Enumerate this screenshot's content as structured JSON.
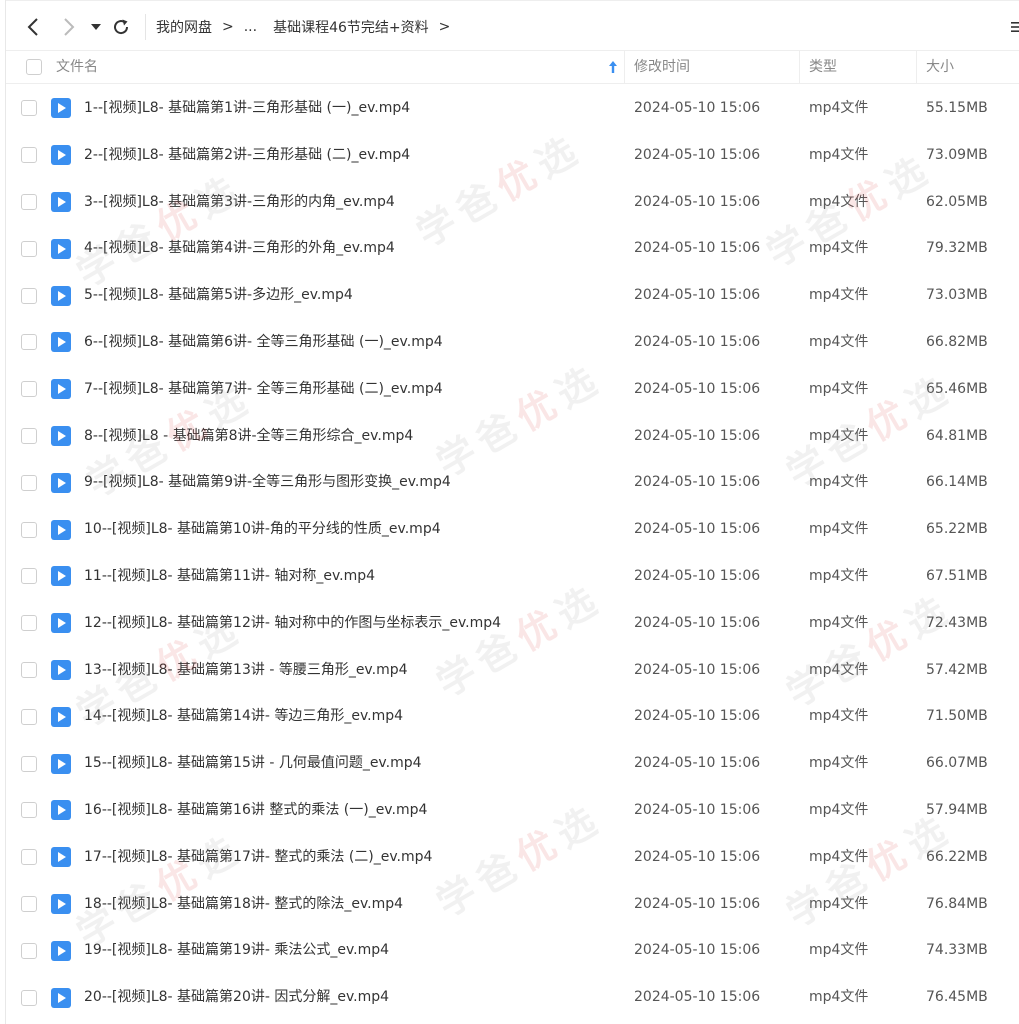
{
  "toolbar": {
    "back_icon": "chevron-left-icon",
    "forward_icon": "chevron-right-icon",
    "history_icon": "caret-down-icon",
    "refresh_icon": "refresh-icon",
    "breadcrumb": [
      "我的网盘",
      "...",
      "基础课程46节完结+资料"
    ],
    "menu_icon": "more-menu-icon"
  },
  "header": {
    "name": "文件名",
    "modified": "修改时间",
    "type": "类型",
    "size": "大小"
  },
  "files": [
    {
      "name": "1--[视频]L8- 基础篇第1讲-三角形基础 (一)_ev.mp4",
      "modified": "2024-05-10 15:06",
      "type": "mp4文件",
      "size": "55.15MB"
    },
    {
      "name": "2--[视频]L8- 基础篇第2讲-三角形基础 (二)_ev.mp4",
      "modified": "2024-05-10 15:06",
      "type": "mp4文件",
      "size": "73.09MB"
    },
    {
      "name": "3--[视频]L8- 基础篇第3讲-三角形的内角_ev.mp4",
      "modified": "2024-05-10 15:06",
      "type": "mp4文件",
      "size": "62.05MB"
    },
    {
      "name": "4--[视频]L8- 基础篇第4讲-三角形的外角_ev.mp4",
      "modified": "2024-05-10 15:06",
      "type": "mp4文件",
      "size": "79.32MB"
    },
    {
      "name": "5--[视频]L8- 基础篇第5讲-多边形_ev.mp4",
      "modified": "2024-05-10 15:06",
      "type": "mp4文件",
      "size": "73.03MB"
    },
    {
      "name": "6--[视频]L8- 基础篇第6讲- 全等三角形基础 (一)_ev.mp4",
      "modified": "2024-05-10 15:06",
      "type": "mp4文件",
      "size": "66.82MB"
    },
    {
      "name": "7--[视频]L8- 基础篇第7讲- 全等三角形基础 (二)_ev.mp4",
      "modified": "2024-05-10 15:06",
      "type": "mp4文件",
      "size": "65.46MB"
    },
    {
      "name": "8--[视频]L8 - 基础篇第8讲-全等三角形综合_ev.mp4",
      "modified": "2024-05-10 15:06",
      "type": "mp4文件",
      "size": "64.81MB"
    },
    {
      "name": "9--[视频]L8- 基础篇第9讲-全等三角形与图形变换_ev.mp4",
      "modified": "2024-05-10 15:06",
      "type": "mp4文件",
      "size": "66.14MB"
    },
    {
      "name": "10--[视频]L8- 基础篇第10讲-角的平分线的性质_ev.mp4",
      "modified": "2024-05-10 15:06",
      "type": "mp4文件",
      "size": "65.22MB"
    },
    {
      "name": "11--[视频]L8- 基础篇第11讲- 轴对称_ev.mp4",
      "modified": "2024-05-10 15:06",
      "type": "mp4文件",
      "size": "67.51MB"
    },
    {
      "name": "12--[视频]L8- 基础篇第12讲- 轴对称中的作图与坐标表示_ev.mp4",
      "modified": "2024-05-10 15:06",
      "type": "mp4文件",
      "size": "72.43MB"
    },
    {
      "name": "13--[视频]L8- 基础篇第13讲 - 等腰三角形_ev.mp4",
      "modified": "2024-05-10 15:06",
      "type": "mp4文件",
      "size": "57.42MB"
    },
    {
      "name": "14--[视频]L8- 基础篇第14讲- 等边三角形_ev.mp4",
      "modified": "2024-05-10 15:06",
      "type": "mp4文件",
      "size": "71.50MB"
    },
    {
      "name": "15--[视频]L8- 基础篇第15讲 - 几何最值问题_ev.mp4",
      "modified": "2024-05-10 15:06",
      "type": "mp4文件",
      "size": "66.07MB"
    },
    {
      "name": "16--[视频]L8- 基础篇第16讲 整式的乘法 (一)_ev.mp4",
      "modified": "2024-05-10 15:06",
      "type": "mp4文件",
      "size": "57.94MB"
    },
    {
      "name": "17--[视频]L8- 基础篇第17讲- 整式的乘法 (二)_ev.mp4",
      "modified": "2024-05-10 15:06",
      "type": "mp4文件",
      "size": "66.22MB"
    },
    {
      "name": "18--[视频]L8- 基础篇第18讲- 整式的除法_ev.mp4",
      "modified": "2024-05-10 15:06",
      "type": "mp4文件",
      "size": "76.84MB"
    },
    {
      "name": "19--[视频]L8- 基础篇第19讲- 乘法公式_ev.mp4",
      "modified": "2024-05-10 15:06",
      "type": "mp4文件",
      "size": "74.33MB"
    },
    {
      "name": "20--[视频]L8- 基础篇第20讲- 因式分解_ev.mp4",
      "modified": "2024-05-10 15:06",
      "type": "mp4文件",
      "size": "76.45MB"
    }
  ],
  "watermark": {
    "prefix": "学爸",
    "highlight": "优",
    "suffix": "选"
  },
  "colors": {
    "accent": "#3a8ff0",
    "border": "#eeeeee",
    "muted": "#888888"
  }
}
